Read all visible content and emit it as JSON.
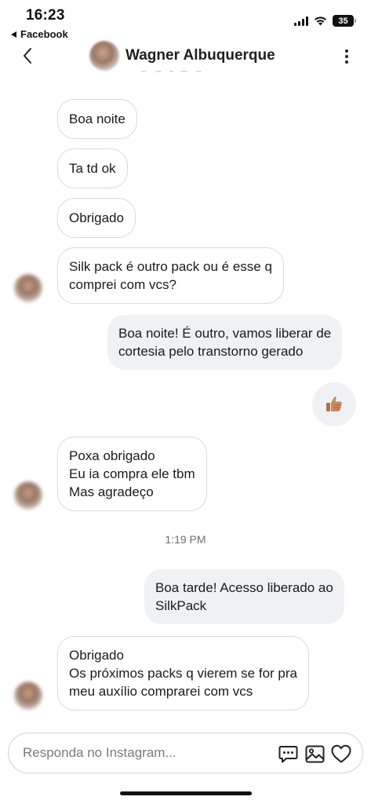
{
  "status_bar": {
    "time": "16:23",
    "back_app": "Facebook",
    "battery": "35"
  },
  "header": {
    "contact_name": "Wagner Albuquerque",
    "back_icon": "chevron-left-icon",
    "more_icon": "more-vertical-icon"
  },
  "messages": [
    {
      "direction": "incoming",
      "text": "Boa noite"
    },
    {
      "direction": "incoming",
      "text": "Ta td ok"
    },
    {
      "direction": "incoming",
      "text": "Obrigado"
    },
    {
      "direction": "incoming",
      "text": "Silk pack é outro pack ou é esse q\ncomprei com vcs?"
    },
    {
      "direction": "outgoing",
      "text": "Boa noite! É outro, vamos liberar de\ncortesia pelo transtorno gerado"
    },
    {
      "direction": "outgoing",
      "emoji": "thumbs-up-icon"
    },
    {
      "direction": "incoming",
      "text": "Poxa obrigado\nEu ia compra ele tbm\nMas agradeço"
    },
    {
      "direction": "outgoing",
      "text": "Boa tarde! Acesso liberado ao\nSilkPack"
    },
    {
      "direction": "incoming",
      "text": "Obrigado\nOs próximos packs q vierem se for pra\nmeu auxílio comprarei com vcs"
    }
  ],
  "timestamp": "1:19 PM",
  "composer": {
    "placeholder": "Responda no Instagram...",
    "icons": [
      "message-icon",
      "image-icon",
      "heart-icon"
    ]
  }
}
